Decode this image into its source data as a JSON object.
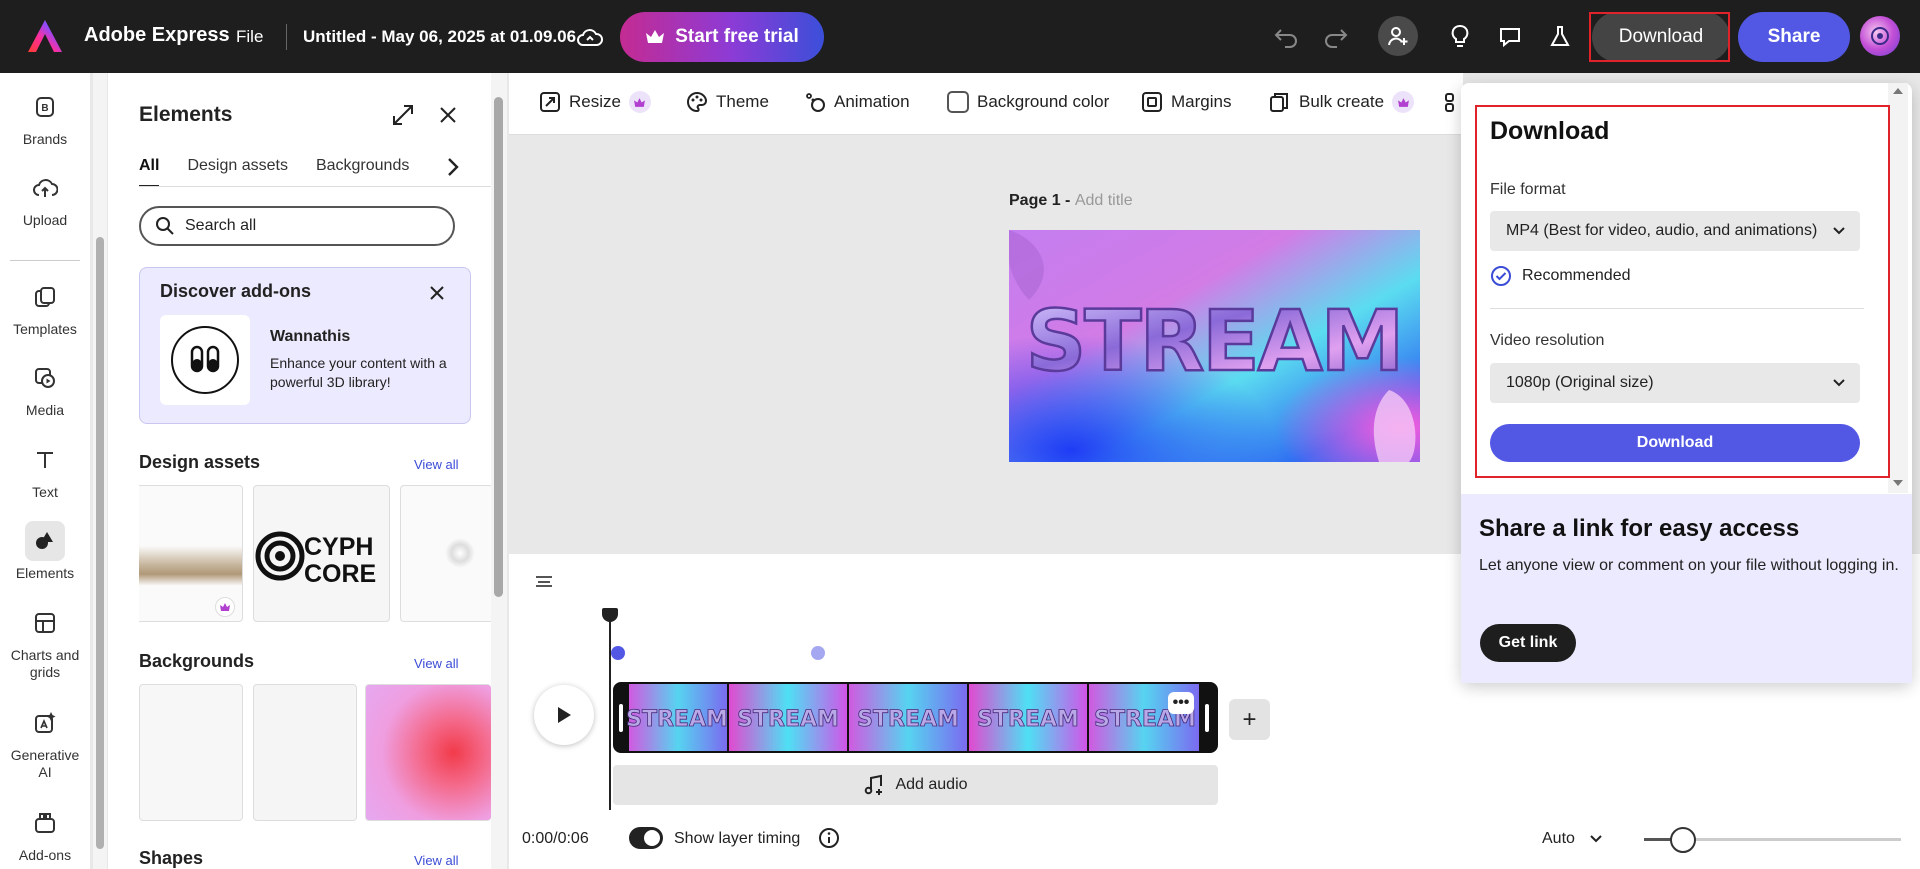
{
  "topbar": {
    "brand": "Adobe Express",
    "file_menu": "File",
    "doc_title": "Untitled - May 06, 2025 at 01.09.06",
    "trial_label": "Start free trial",
    "download_label": "Download",
    "share_label": "Share"
  },
  "rail": {
    "items": [
      {
        "label": "Brands",
        "icon": "brand-icon"
      },
      {
        "label": "Upload",
        "icon": "upload-icon"
      },
      {
        "label": "Templates",
        "icon": "templates-icon"
      },
      {
        "label": "Media",
        "icon": "media-icon"
      },
      {
        "label": "Text",
        "icon": "text-icon"
      },
      {
        "label": "Elements",
        "icon": "elements-icon"
      },
      {
        "label": "Charts and grids",
        "icon": "charts-icon"
      },
      {
        "label": "Generative AI",
        "icon": "generative-ai-icon"
      },
      {
        "label": "Add-ons",
        "icon": "addons-icon"
      }
    ],
    "active": "Elements"
  },
  "panel": {
    "title": "Elements",
    "tabs": [
      "All",
      "Design assets",
      "Backgrounds"
    ],
    "active_tab": "All",
    "search_placeholder": "Search all",
    "addons": {
      "title": "Discover add-ons",
      "name": "Wannathis",
      "desc": "Enhance your content with a powerful 3D library!"
    },
    "sections": {
      "design_assets": "Design assets",
      "backgrounds": "Backgrounds",
      "shapes": "Shapes",
      "view_all": "View all"
    },
    "cyph_logo_text": [
      "CYPH",
      "CORE"
    ]
  },
  "toolbar": {
    "items": [
      {
        "label": "Resize",
        "icon": "resize-icon",
        "premium": true
      },
      {
        "label": "Theme",
        "icon": "palette-icon",
        "premium": false
      },
      {
        "label": "Animation",
        "icon": "animation-icon",
        "premium": false
      },
      {
        "label": "Background color",
        "icon": "color-swatch-icon",
        "premium": false
      },
      {
        "label": "Margins",
        "icon": "margins-icon",
        "premium": false
      },
      {
        "label": "Bulk create",
        "icon": "bulk-create-icon",
        "premium": true
      }
    ]
  },
  "canvas": {
    "page_label": "Page 1 - ",
    "page_sub": "Add title",
    "artwork_text": "STREAM"
  },
  "timeline": {
    "frame_text": "STREAM",
    "add_audio": "Add audio",
    "time": "0:00/0:06",
    "show_layer_timing": "Show layer timing",
    "zoom": "Auto",
    "zoom_level": 0.15
  },
  "download_panel": {
    "title": "Download",
    "file_format_label": "File format",
    "file_format_value": "MP4 (Best for video, audio, and animations)",
    "recommended": "Recommended",
    "resolution_label": "Video resolution",
    "resolution_value": "1080p (Original size)",
    "download_button": "Download"
  },
  "share_link": {
    "title": "Share a link for easy access",
    "desc": "Let anyone view or comment on your file without logging in.",
    "button": "Get link"
  },
  "colors": {
    "topbar_bg": "#1e1e1e",
    "accent": "#5258e4",
    "highlight_outline": "#e0232b",
    "addon_bg": "#eceafe"
  }
}
